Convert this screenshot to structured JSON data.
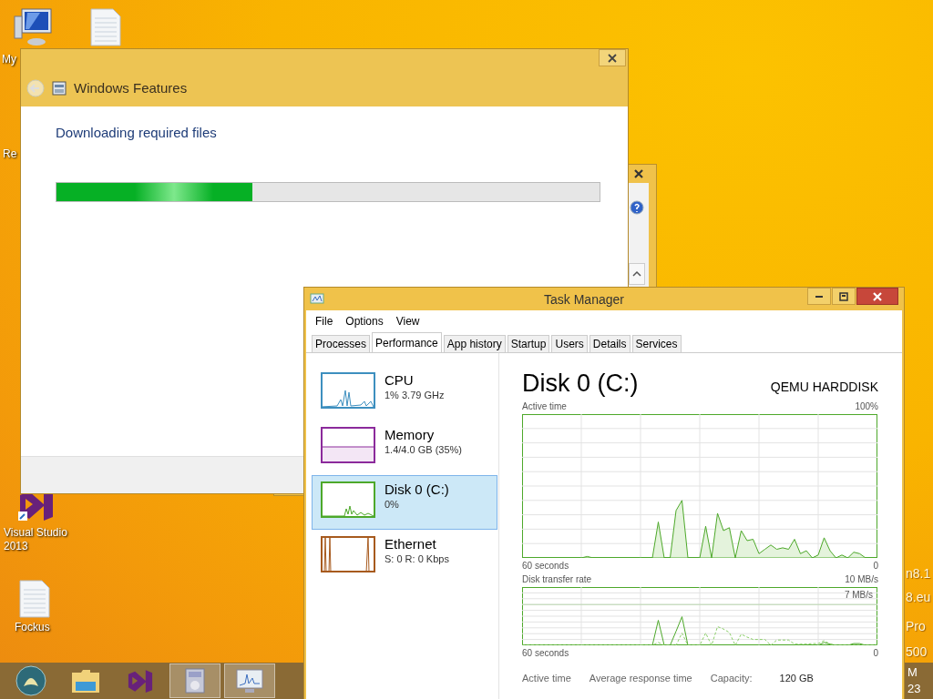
{
  "desktop": {
    "icons": [
      {
        "kind": "computer",
        "label": "My"
      },
      {
        "kind": "notepad"
      },
      {
        "kind": "label-only",
        "label": "Re"
      },
      {
        "kind": "vs",
        "label": "Visual Studio 2013"
      },
      {
        "kind": "notepad",
        "label": "Fockus"
      }
    ],
    "corner_text": [
      "n8.1",
      "8.eu",
      "Pro",
      "500"
    ]
  },
  "features_window": {
    "title": "Windows Features",
    "heading": "Downloading required files",
    "progress": {
      "level": 0.36
    }
  },
  "task_manager": {
    "title": "Task Manager",
    "menu": [
      "File",
      "Options",
      "View"
    ],
    "tabs": [
      {
        "label": "Processes",
        "selected": false
      },
      {
        "label": "Performance",
        "selected": true
      },
      {
        "label": "App history",
        "selected": false
      },
      {
        "label": "Startup",
        "selected": false
      },
      {
        "label": "Users",
        "selected": false
      },
      {
        "label": "Details",
        "selected": false
      },
      {
        "label": "Services",
        "selected": false
      }
    ],
    "resources": [
      {
        "kind": "cpu",
        "name": "CPU",
        "detail": "1% 3.79 GHz",
        "selected": false,
        "color": "#3d8fbf"
      },
      {
        "kind": "memory",
        "name": "Memory",
        "detail": "1.4/4.0 GB (35%)",
        "selected": false,
        "color": "#8b2a9b"
      },
      {
        "kind": "disk",
        "name": "Disk 0 (C:)",
        "detail": "0%",
        "selected": true,
        "color": "#4da82a"
      },
      {
        "kind": "network",
        "name": "Ethernet",
        "detail": "S: 0 R: 0 Kbps",
        "selected": false,
        "color": "#a75a1e"
      }
    ],
    "detail": {
      "title": "Disk 0 (C:)",
      "model": "QEMU HARDDISK",
      "charts": [
        {
          "kind": "area",
          "title": "Active time",
          "max_label": "100%",
          "start_label": "60 seconds",
          "end_label": "0"
        },
        {
          "kind": "lines",
          "title": "Disk transfer rate",
          "max_label": "10 MB/s",
          "scale_label": "7 MB/s",
          "start_label": "60 seconds",
          "end_label": "0"
        }
      ],
      "stats": [
        {
          "label": "Active time"
        },
        {
          "label": "Average response time"
        },
        {
          "label": "Capacity:",
          "value": "120 GB"
        }
      ]
    }
  },
  "taskbar": {
    "items": [
      {
        "kind": "start",
        "active": false
      },
      {
        "kind": "folder",
        "active": false
      },
      {
        "kind": "vs",
        "active": false
      },
      {
        "kind": "installer",
        "active": true
      },
      {
        "kind": "monitor",
        "active": true
      }
    ],
    "clock": [
      "M",
      "23"
    ]
  }
}
